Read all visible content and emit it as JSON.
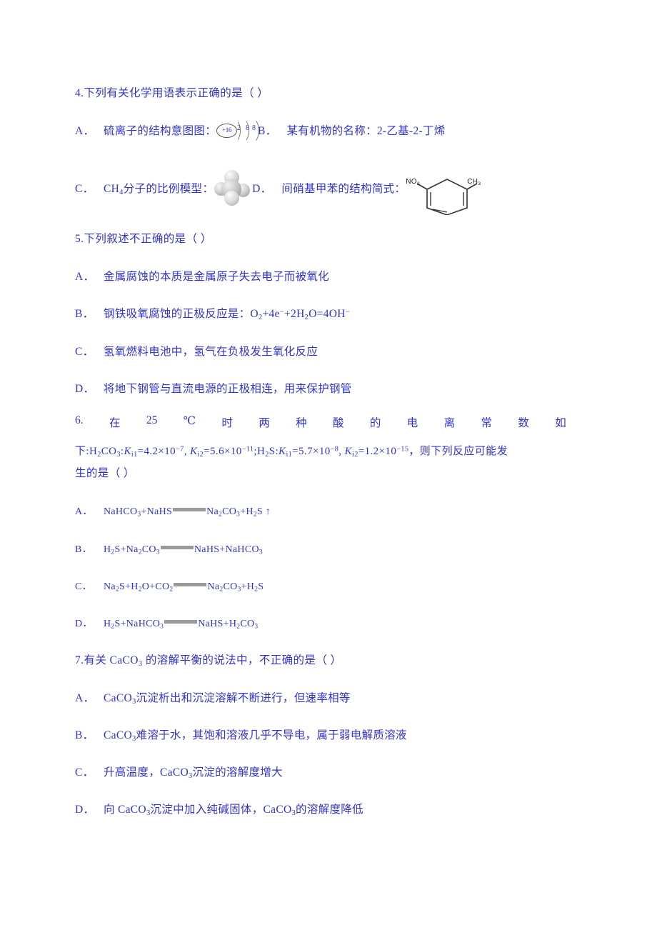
{
  "document": {
    "text_color": "#3333cc",
    "questions": [
      {
        "number": "4.",
        "stem": "下列有关化学用语表示正确的是（      ）",
        "options": [
          {
            "label": "A．",
            "text_before": "硫离子的结构意图图：",
            "figure": "sulfur-ion-shell-diagram"
          },
          {
            "label": "B．",
            "text_before": "某有机物的名称：2-乙基-2-丁烯",
            "figure": ""
          },
          {
            "label": "C．",
            "text_before": "CH4分子的比例模型：",
            "figure": "methane-space-filling-model"
          },
          {
            "label": "D．",
            "text_before": "间硝基甲苯的结构简式：",
            "figure": "nitrotoluene-structure"
          }
        ],
        "figures": {
          "sulfur_ion": {
            "nucleus": "+16",
            "shells": [
              "2",
              "8",
              "8"
            ]
          },
          "nitrotoluene": {
            "substituent_left": "NO",
            "substituent_left_sub": "2",
            "substituent_right": "CH",
            "substituent_right_sub": "3"
          }
        }
      },
      {
        "number": "5.",
        "stem": "下列叙述不正确的是（      ）",
        "options": [
          {
            "label": "A．",
            "text": "金属腐蚀的本质是金属原子失去电子而被氧化"
          },
          {
            "label": "B．",
            "text": "钢铁吸氧腐蚀的正极反应是：",
            "equation": "O2+4e−+2H2O=4OH−"
          },
          {
            "label": "C．",
            "text": "氢氧燃料电池中，氢气在负极发生氧化反应"
          },
          {
            "label": "D．",
            "text": "将地下钢管与直流电源的正极相连，用来保护钢管"
          }
        ]
      },
      {
        "number": "6.",
        "stem_words": [
          "6.",
          "在",
          "25",
          "℃",
          "时",
          "两",
          "种",
          "酸",
          "的",
          "电",
          "离",
          "常",
          "数",
          "如"
        ],
        "stem_line2_prefix": "下",
        "constants": {
          "acid1": "H2CO3",
          "acid1_ki1": "4.2×10−7",
          "acid1_ki2": "5.6×10−11",
          "acid2": "H2S",
          "acid2_ki1": "5.7×10−8",
          "acid2_ki2": "1.2×10−15"
        },
        "stem_line2_suffix": "，则下列反应可能发",
        "stem_line3": "生的是（ ）",
        "options": [
          {
            "label": "A．",
            "left": "NaHCO3+NaHS",
            "right": "Na2CO3+H2S↑"
          },
          {
            "label": "B．",
            "left": "H2S+Na2CO3",
            "right": "NaHS+NaHCO3"
          },
          {
            "label": "C．",
            "left": "Na2S+H2O+CO2",
            "right": "Na2CO3+H2S"
          },
          {
            "label": "D．",
            "left": "H2S+NaHCO3",
            "right": "NaHS+H2CO3"
          }
        ]
      },
      {
        "number": "7.",
        "stem": "有关 CaCO3 的溶解平衡的说法中，不正确的是（      ）",
        "options": [
          {
            "label": "A．",
            "text": "CaCO3沉淀析出和沉淀溶解不断进行，但速率相等"
          },
          {
            "label": "B．",
            "text": "CaCO3难溶于水，其饱和溶液几乎不导电，属于弱电解质溶液"
          },
          {
            "label": "C．",
            "text": "升高温度，CaCO3沉淀的溶解度增大"
          },
          {
            "label": "D．",
            "text": "向 CaCO3沉淀中加入纯碱固体，CaCO3的溶解度降低"
          }
        ]
      }
    ]
  }
}
